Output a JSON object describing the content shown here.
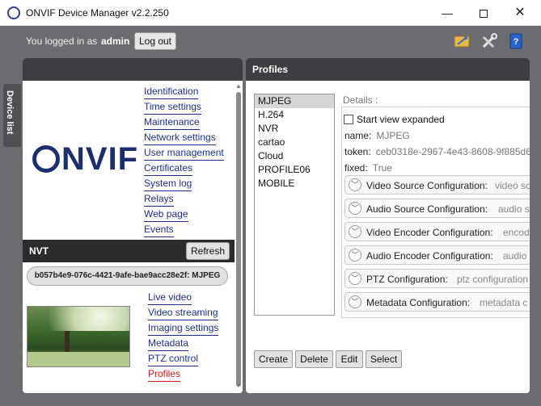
{
  "window": {
    "title": "ONVIF Device Manager v2.2.250",
    "minimize": "—",
    "close": "✕"
  },
  "login": {
    "prefix": "You logged in as",
    "user": "admin",
    "logout_label": "Log out"
  },
  "device_list_tab": "Device list",
  "left_panel": {
    "logo_text": "NVIF",
    "menu": [
      "Identification",
      "Time settings",
      "Maintenance",
      "Network settings",
      "User management",
      "Certificates",
      "System log",
      "Relays",
      "Web page",
      "Events"
    ],
    "nvt_label": "NVT",
    "refresh_label": "Refresh",
    "token_pill": "b057b4e9-076c-4421-9afe-bae9acc28e2f: MJPEG",
    "nvt_menu": [
      "Live video",
      "Video streaming",
      "Imaging settings",
      "Metadata",
      "PTZ control",
      "Profiles"
    ],
    "active_nvt_item": "Profiles"
  },
  "right_panel": {
    "title": "Profiles",
    "profiles": [
      "MJPEG",
      "H.264",
      "NVR",
      "cartao",
      "Cloud",
      "PROFILE06",
      "MOBILE"
    ],
    "selected_profile": "MJPEG",
    "details_label": "Details :",
    "start_view_expanded": "Start view expanded",
    "start_view_checked": false,
    "name_key": "name:",
    "name_value": "MJPEG",
    "token_key": "token:",
    "token_value": "ceb0318e-2967-4e43-8608-9f885d6",
    "fixed_key": "fixed:",
    "fixed_value": "True",
    "configs": [
      {
        "title": "Video Source Configuration:",
        "sub": "video so"
      },
      {
        "title": "Audio Source Configuration:",
        "sub": "audio s"
      },
      {
        "title": "Video Encoder Configuration:",
        "sub": "encod"
      },
      {
        "title": "Audio Encoder Configuration:",
        "sub": "audio"
      },
      {
        "title": "PTZ Configuration:",
        "sub": "ptz configuration"
      },
      {
        "title": "Metadata Configuration:",
        "sub": "metadata c"
      }
    ],
    "buttons": {
      "create": "Create",
      "delete": "Delete",
      "edit": "Edit",
      "select": "Select"
    }
  },
  "icons": [
    "app-icon",
    "minimize-icon",
    "maximize-icon",
    "close-icon",
    "upgrade-icon",
    "settings-tools-icon",
    "help-book-icon",
    "chevron-down-icon"
  ],
  "colors": {
    "frame_bg": "#6a6c70",
    "panel_header": "#3e3f42",
    "menu_link": "#1c2f8c",
    "active_link": "#cc1f1f"
  }
}
